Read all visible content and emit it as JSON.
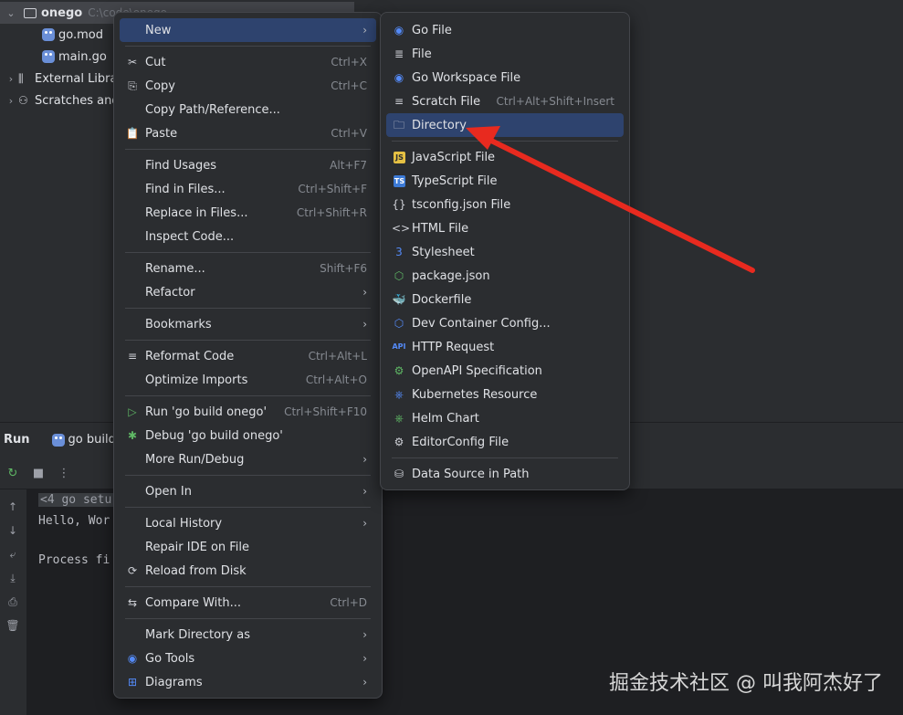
{
  "project_tree": {
    "root": {
      "name": "onego",
      "path": "C:\\code\\onego"
    },
    "files": [
      "go.mod",
      "main.go"
    ],
    "external": "External Libra",
    "scratches": "Scratches and"
  },
  "run_panel": {
    "title": "Run",
    "tab": "go build",
    "console": [
      "<4 go setu",
      "Hello, Wor",
      "Process fi"
    ]
  },
  "context_menu": [
    {
      "label": "New",
      "submenu": true,
      "active": true
    },
    {
      "sep": true
    },
    {
      "label": "Cut",
      "shortcut": "Ctrl+X",
      "icon": "scissors-icon",
      "glyph": "✂"
    },
    {
      "label": "Copy",
      "shortcut": "Ctrl+C",
      "icon": "copy-icon",
      "glyph": "⎘"
    },
    {
      "label": "Copy Path/Reference..."
    },
    {
      "label": "Paste",
      "shortcut": "Ctrl+V",
      "icon": "paste-icon",
      "glyph": "📋"
    },
    {
      "sep": true
    },
    {
      "label": "Find Usages",
      "shortcut": "Alt+F7"
    },
    {
      "label": "Find in Files...",
      "shortcut": "Ctrl+Shift+F"
    },
    {
      "label": "Replace in Files...",
      "shortcut": "Ctrl+Shift+R"
    },
    {
      "label": "Inspect Code..."
    },
    {
      "sep": true
    },
    {
      "label": "Rename...",
      "shortcut": "Shift+F6"
    },
    {
      "label": "Refactor",
      "submenu": true
    },
    {
      "sep": true
    },
    {
      "label": "Bookmarks",
      "submenu": true
    },
    {
      "sep": true
    },
    {
      "label": "Reformat Code",
      "shortcut": "Ctrl+Alt+L",
      "icon": "reformat-icon",
      "glyph": "≡"
    },
    {
      "label": "Optimize Imports",
      "shortcut": "Ctrl+Alt+O"
    },
    {
      "sep": true
    },
    {
      "label": "Run 'go build onego'",
      "shortcut": "Ctrl+Shift+F10",
      "icon": "run-icon",
      "glyph": "▷",
      "icon_color": "green"
    },
    {
      "label": "Debug 'go build onego'",
      "icon": "debug-icon",
      "glyph": "✱",
      "icon_color": "green"
    },
    {
      "label": "More Run/Debug",
      "submenu": true
    },
    {
      "sep": true
    },
    {
      "label": "Open In",
      "submenu": true
    },
    {
      "sep": true
    },
    {
      "label": "Local History",
      "submenu": true
    },
    {
      "label": "Repair IDE on File"
    },
    {
      "label": "Reload from Disk",
      "icon": "reload-icon",
      "glyph": "⟳"
    },
    {
      "sep": true
    },
    {
      "label": "Compare With...",
      "shortcut": "Ctrl+D",
      "icon": "compare-icon",
      "glyph": "⇆"
    },
    {
      "sep": true
    },
    {
      "label": "Mark Directory as",
      "submenu": true
    },
    {
      "label": "Go Tools",
      "submenu": true,
      "icon": "gopher-icon",
      "glyph": "◉",
      "icon_color": "blue"
    },
    {
      "label": "Diagrams",
      "submenu": true,
      "icon": "diagram-icon",
      "glyph": "⊞",
      "icon_color": "blue"
    }
  ],
  "new_submenu": [
    {
      "label": "Go File",
      "icon": "gopher-icon",
      "glyph": "◉",
      "icon_color": "blue"
    },
    {
      "label": "File",
      "icon": "file-icon",
      "glyph": "≣"
    },
    {
      "label": "Go Workspace File",
      "icon": "gopher-icon",
      "glyph": "◉",
      "icon_color": "blue"
    },
    {
      "label": "Scratch File",
      "shortcut": "Ctrl+Alt+Shift+Insert",
      "icon": "scratch-icon",
      "glyph": "≡"
    },
    {
      "label": "Directory",
      "icon": "folder-icon",
      "glyph": "🗀",
      "active": true
    },
    {
      "sep": true
    },
    {
      "label": "JavaScript File",
      "icon": "js-icon",
      "glyph": "JS"
    },
    {
      "label": "TypeScript File",
      "icon": "ts-icon",
      "glyph": "TS"
    },
    {
      "label": "tsconfig.json File",
      "icon": "braces-icon",
      "glyph": "{}"
    },
    {
      "label": "HTML File",
      "icon": "html-icon",
      "glyph": "<>"
    },
    {
      "label": "Stylesheet",
      "icon": "css-icon",
      "glyph": "3",
      "icon_color": "blue"
    },
    {
      "label": "package.json",
      "icon": "node-icon",
      "glyph": "⬡",
      "icon_color": "green"
    },
    {
      "label": "Dockerfile",
      "icon": "docker-icon",
      "glyph": "🐳",
      "icon_color": "blue"
    },
    {
      "label": "Dev Container Config...",
      "icon": "container-icon",
      "glyph": "⬡",
      "icon_color": "blue"
    },
    {
      "label": "HTTP Request",
      "icon": "api-icon",
      "glyph": "API"
    },
    {
      "label": "OpenAPI Specification",
      "icon": "openapi-icon",
      "glyph": "⚙",
      "icon_color": "green"
    },
    {
      "label": "Kubernetes Resource",
      "icon": "kubernetes-icon",
      "glyph": "⎈",
      "icon_color": "blue"
    },
    {
      "label": "Helm Chart",
      "icon": "helm-icon",
      "glyph": "⎈",
      "icon_color": "green"
    },
    {
      "label": "EditorConfig File",
      "icon": "gear-icon",
      "glyph": "⚙"
    },
    {
      "sep": true
    },
    {
      "label": "Data Source in Path",
      "icon": "database-icon",
      "glyph": "⛁"
    }
  ],
  "watermark": "掘金技术社区 @ 叫我阿杰好了",
  "colors": {
    "accent": "#2e436e",
    "arrow": "#e82a1f",
    "menu_bg": "#2b2d30"
  }
}
